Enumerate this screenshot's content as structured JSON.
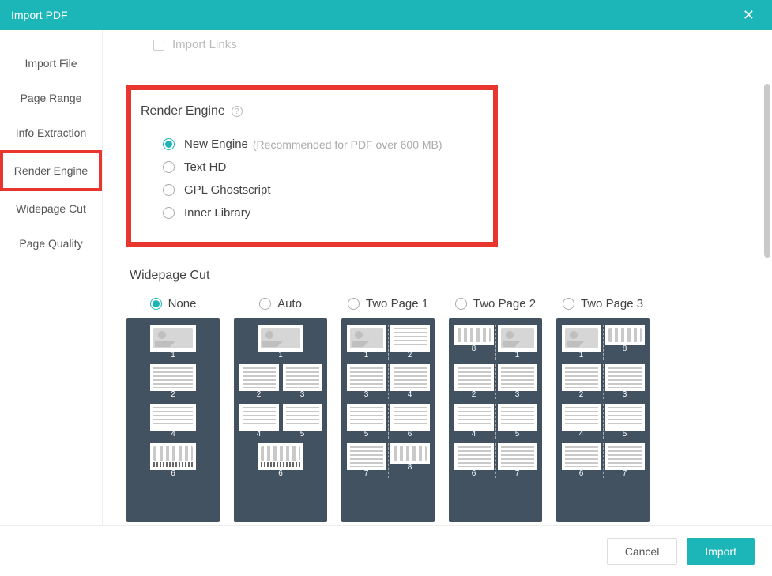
{
  "titlebar": {
    "title": "Import PDF"
  },
  "sidebar": {
    "items": [
      {
        "label": "Import File"
      },
      {
        "label": "Page Range"
      },
      {
        "label": "Info Extraction"
      },
      {
        "label": "Render Engine"
      },
      {
        "label": "Widepage Cut"
      },
      {
        "label": "Page Quality"
      }
    ]
  },
  "prev": {
    "import_links": "Import Links"
  },
  "render": {
    "title": "Render Engine",
    "options": [
      {
        "label": "New Engine",
        "hint": "(Recommended for PDF over 600 MB)",
        "checked": true
      },
      {
        "label": "Text HD",
        "hint": "",
        "checked": false
      },
      {
        "label": "GPL Ghostscript",
        "hint": "",
        "checked": false
      },
      {
        "label": "Inner Library",
        "hint": "",
        "checked": false
      }
    ]
  },
  "widepage": {
    "title": "Widepage Cut",
    "options": [
      {
        "label": "None",
        "checked": true
      },
      {
        "label": "Auto",
        "checked": false
      },
      {
        "label": "Two Page 1",
        "checked": false
      },
      {
        "label": "Two Page 2",
        "checked": false
      },
      {
        "label": "Two Page 3",
        "checked": false
      }
    ],
    "previews": {
      "none": [
        "1",
        "2",
        "4",
        "6"
      ],
      "auto": [
        "1",
        "2",
        "3",
        "4",
        "5",
        "6"
      ],
      "tp1": [
        "1",
        "2",
        "3",
        "4",
        "5",
        "6",
        "7",
        "8"
      ],
      "tp2": [
        "8",
        "1",
        "2",
        "3",
        "4",
        "5",
        "6",
        "7"
      ],
      "tp3": [
        "1",
        "8",
        "2",
        "3",
        "4",
        "5",
        "6",
        "7"
      ]
    }
  },
  "footer": {
    "cancel": "Cancel",
    "import": "Import"
  }
}
